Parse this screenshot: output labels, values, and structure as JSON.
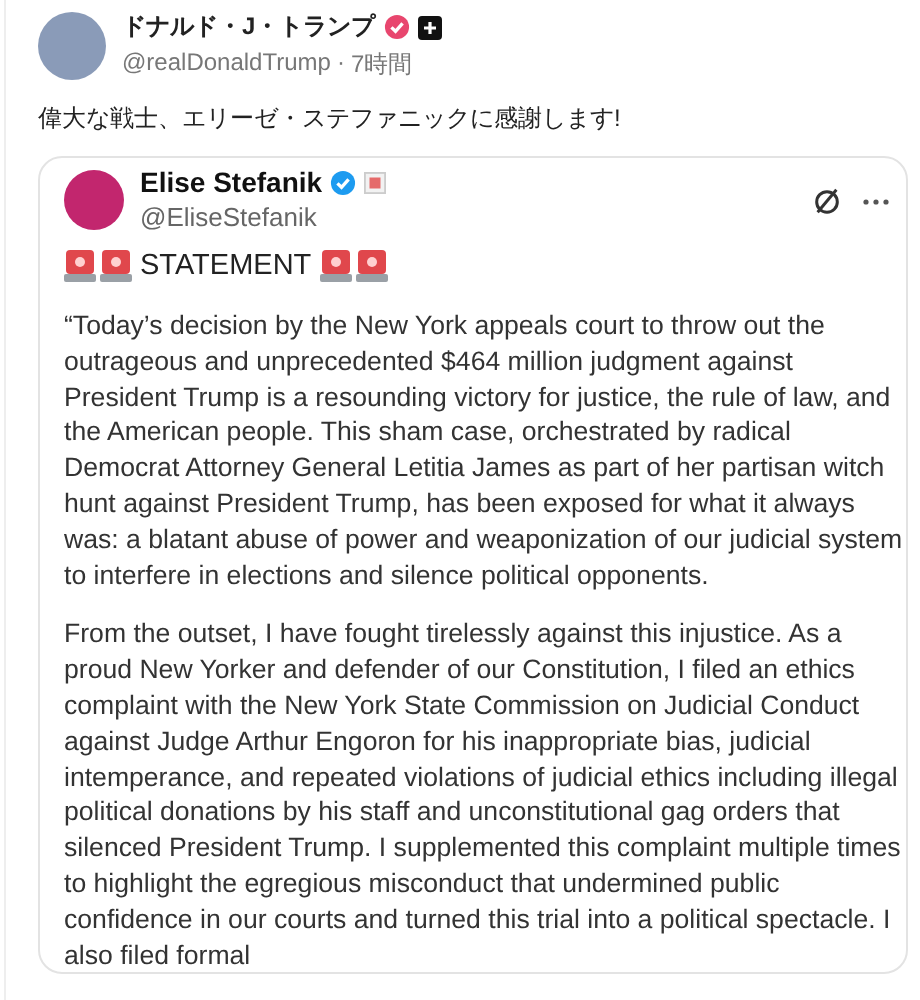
{
  "post": {
    "author": {
      "name": "ドナルド・J・トランプ",
      "handle": "@realDonaldTrump",
      "separator": "·",
      "time": "7時間",
      "verified": true
    },
    "text": "偉大な戦士、エリーゼ・ステファニックに感謝します!",
    "quote": {
      "author": {
        "name": "Elise Stefanik",
        "handle": "@EliseStefanik",
        "verified": true
      },
      "heading": "STATEMENT",
      "paragraphs": [
        "“Today’s decision by the New York appeals court to throw out the outrageous and unprecedented $464 million judgment against President Trump is a resounding victory for justice, the rule of law, and the American people. This sham case, orchestrated by radical Democrat Attorney General Letitia James as part of her partisan witch hunt against President Trump, has been exposed for what it always was: a blatant abuse of power and weaponization of our judicial system to interfere in elections and silence political opponents.",
        "From the outset, I have fought tirelessly against this injustice. As a proud New Yorker and defender of our Constitution, I filed an ethics complaint with the New York State Commission on Judicial Conduct against Judge Arthur Engoron for his inappropriate bias, judicial intemperance, and repeated violations of judicial ethics including illegal political donations by his staff and unconstitutional gag orders that silenced President Trump. I supplemented this complaint multiple times to highlight the egregious misconduct that undermined public confidence in our courts and turned this trial into a political spectacle. I also filed formal"
      ]
    }
  }
}
